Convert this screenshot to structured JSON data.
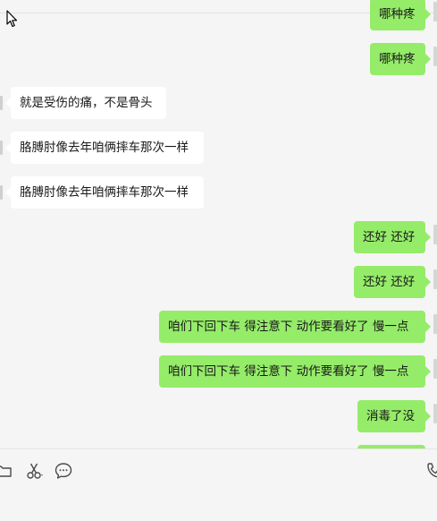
{
  "window": {
    "title": ""
  },
  "chat": {
    "messages": [
      {
        "side": "out",
        "text": "哪种疼"
      },
      {
        "side": "out",
        "text": "哪种疼"
      },
      {
        "side": "in",
        "text": "就是受伤的痛，不是骨头"
      },
      {
        "side": "in",
        "text": "胳膊肘像去年咱俩摔车那次一样"
      },
      {
        "side": "in",
        "text": "胳膊肘像去年咱俩摔车那次一样"
      },
      {
        "side": "out",
        "text": "还好 还好"
      },
      {
        "side": "out",
        "text": "还好 还好"
      },
      {
        "side": "out",
        "text": "咱们下回下车 得注意下 动作要看好了 慢一点"
      },
      {
        "side": "out",
        "text": "咱们下回下车 得注意下 动作要看好了 慢一点"
      },
      {
        "side": "out",
        "text": "消毒了没"
      },
      {
        "side": "out",
        "text": ""
      }
    ]
  },
  "toolbar": {
    "icons": [
      "folder-icon",
      "scissors-icon",
      "chat-bubble-icon",
      "phone-icon"
    ]
  },
  "colors": {
    "outgoing_bubble": "#95ec69",
    "incoming_bubble": "#ffffff",
    "background": "#f5f5f5"
  }
}
